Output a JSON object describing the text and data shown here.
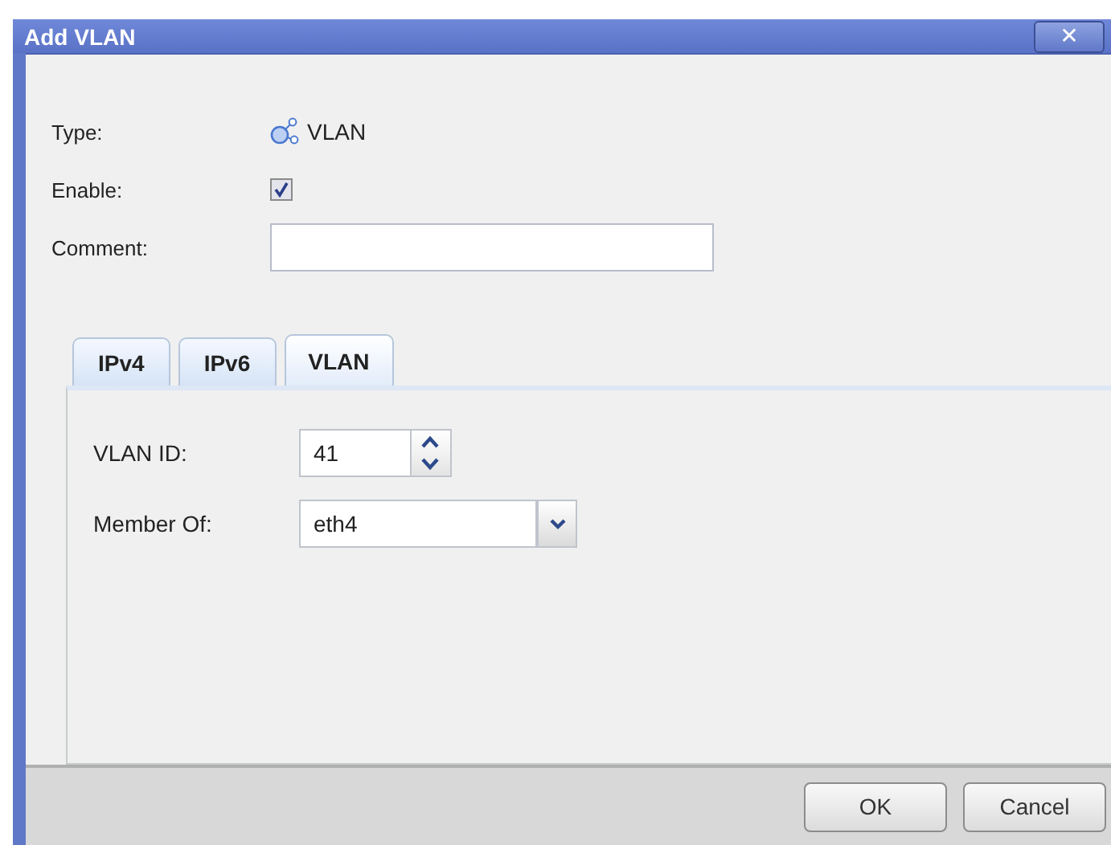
{
  "window": {
    "title": "Add VLAN",
    "close": "✕"
  },
  "fields": [
    {
      "kind": "type",
      "label": "Type:",
      "value": "VLAN"
    },
    {
      "kind": "checkbox",
      "label": "Enable:",
      "checked": true
    },
    {
      "kind": "text",
      "label": "Comment:"
    }
  ],
  "tabs": [
    {
      "label": "IPv4",
      "selected": false
    },
    {
      "label": "IPv6",
      "selected": false
    },
    {
      "label": "VLAN",
      "selected": true
    }
  ],
  "vlan": [
    {
      "kind": "spinner",
      "label": "VLAN ID:",
      "value": "41"
    },
    {
      "kind": "combo",
      "label": "Member Of:",
      "value": "eth4"
    }
  ],
  "buttons": [
    "OK",
    "Cancel"
  ]
}
